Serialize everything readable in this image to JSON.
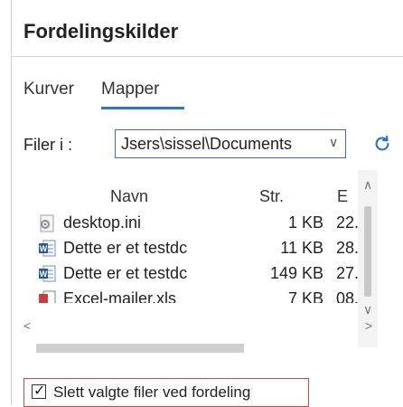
{
  "panel": {
    "title": "Fordelingskilder",
    "tabs": [
      {
        "label": "Kurver",
        "active": false
      },
      {
        "label": "Mapper",
        "active": true
      }
    ],
    "accent_color": "#2d78c8"
  },
  "files_in": {
    "label": "Filer i :",
    "path": "Jsers\\sissel\\Documents",
    "refresh_icon": "refresh-icon"
  },
  "table": {
    "columns": {
      "name": "Navn",
      "size": "Str.",
      "ext": "E"
    },
    "rows": [
      {
        "name": "desktop.ini",
        "size": "1 KB",
        "ext": "22.",
        "icon": "settings-file-icon"
      },
      {
        "name": "Dette er et testdc",
        "size": "11 KB",
        "ext": "28.(",
        "icon": "word-document-icon"
      },
      {
        "name": "Dette er et testdc",
        "size": "149 KB",
        "ext": "27.(",
        "icon": "word-document-icon"
      },
      {
        "name": "Excel-mailer.xls",
        "size": "7 KB",
        "ext": "08.(",
        "icon": "excel-file-icon"
      }
    ]
  },
  "delete_option": {
    "label": "Slett valgte filer ved fordeling",
    "checked": true
  }
}
